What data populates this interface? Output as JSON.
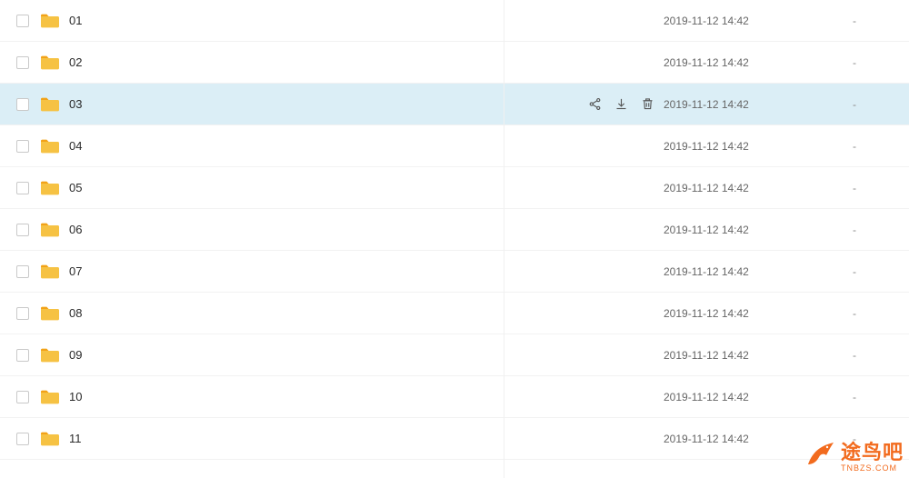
{
  "hovered_index": 2,
  "rows": [
    {
      "name": "01",
      "date": "2019-11-12 14:42",
      "size": "-"
    },
    {
      "name": "02",
      "date": "2019-11-12 14:42",
      "size": "-"
    },
    {
      "name": "03",
      "date": "2019-11-12 14:42",
      "size": "-"
    },
    {
      "name": "04",
      "date": "2019-11-12 14:42",
      "size": "-"
    },
    {
      "name": "05",
      "date": "2019-11-12 14:42",
      "size": "-"
    },
    {
      "name": "06",
      "date": "2019-11-12 14:42",
      "size": "-"
    },
    {
      "name": "07",
      "date": "2019-11-12 14:42",
      "size": "-"
    },
    {
      "name": "08",
      "date": "2019-11-12 14:42",
      "size": "-"
    },
    {
      "name": "09",
      "date": "2019-11-12 14:42",
      "size": "-"
    },
    {
      "name": "10",
      "date": "2019-11-12 14:42",
      "size": "-"
    },
    {
      "name": "11",
      "date": "2019-11-12 14:42",
      "size": "-"
    }
  ],
  "row_actions": {
    "share": "share-icon",
    "download": "download-icon",
    "more": "delete-icon"
  },
  "watermark": {
    "title": "途鸟吧",
    "sub": "TNBZS.COM"
  },
  "colors": {
    "folder_body": "#f6c243",
    "folder_tab": "#f2a218",
    "hover_bg": "#dbeef6",
    "brand": "#f26b1e"
  }
}
